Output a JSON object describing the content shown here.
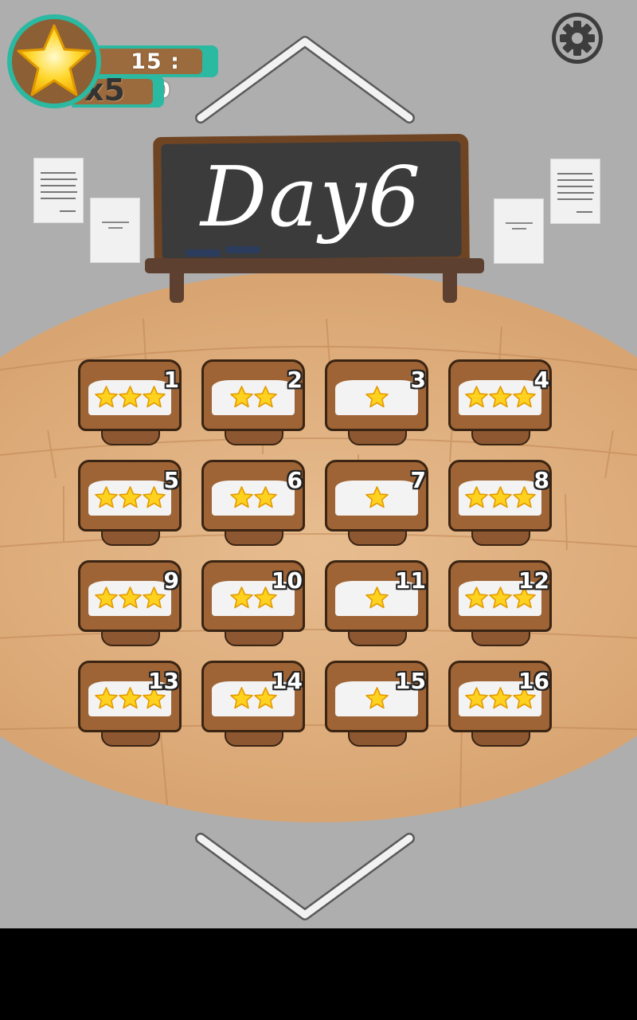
{
  "hud": {
    "timer": "15 : 00",
    "star_count": "x5",
    "coin_icon": "star-icon",
    "settings_icon": "gear-icon"
  },
  "navigation": {
    "up_icon": "chevron-up-icon",
    "down_icon": "chevron-down-icon"
  },
  "blackboard": {
    "title": "Day6"
  },
  "levels": [
    {
      "label": "1",
      "stars": 3
    },
    {
      "label": "2",
      "stars": 2
    },
    {
      "label": "3",
      "stars": 1
    },
    {
      "label": "4",
      "stars": 3
    },
    {
      "label": "5",
      "stars": 3
    },
    {
      "label": "6",
      "stars": 2
    },
    {
      "label": "7",
      "stars": 1
    },
    {
      "label": "8",
      "stars": 3
    },
    {
      "label": "9",
      "stars": 3
    },
    {
      "label": "10",
      "stars": 2
    },
    {
      "label": "11",
      "stars": 1
    },
    {
      "label": "12",
      "stars": 3
    },
    {
      "label": "13",
      "stars": 3
    },
    {
      "label": "14",
      "stars": 2
    },
    {
      "label": "15",
      "stars": 1
    },
    {
      "label": "16",
      "stars": 3
    }
  ],
  "colors": {
    "background": "#aeaeae",
    "hud_accent": "#2bb9a2",
    "wood": "#9f6435",
    "floor": "#dcaa78",
    "star": "#ffd21f"
  }
}
